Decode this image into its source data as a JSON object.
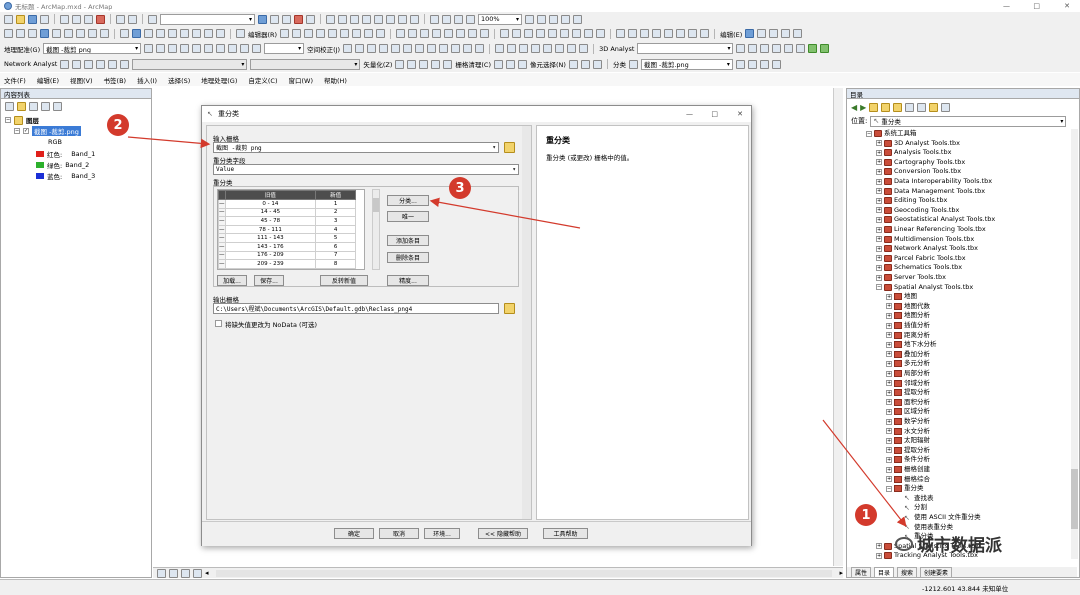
{
  "window": {
    "title": "无标题 - ArcMap.mxd - ArcMap"
  },
  "toolbar2": {
    "scale": "100%"
  },
  "toolbar3": {
    "georef_label": "地理配准(G)",
    "layer_combo": "截图 -裁剪 png",
    "adjust_label": "空间校正(J)",
    "analyst_3d": "3D Analyst"
  },
  "editor_label": "编辑器(R)",
  "edit_label": "编辑(E)",
  "toolbar4": {
    "network_analyst": "Network Analyst",
    "vectorize_label": "矢量化(Z)",
    "raster_clean": "栅格清理(C)",
    "cell_select": "像元选择(N)",
    "classify": "分类",
    "classify_layer": "截图 -裁剪.png"
  },
  "menu": {
    "items": [
      "文件(F)",
      "编辑(E)",
      "视图(V)",
      "书签(B)",
      "插入(I)",
      "选择(S)",
      "地理处理(G)",
      "自定义(C)",
      "窗口(W)",
      "帮助(H)"
    ]
  },
  "toc": {
    "title": "内容列表",
    "layers_root": "图层",
    "layer": "截图 -裁剪.png",
    "rgb": "RGB",
    "bands": [
      {
        "prefix": "红色:",
        "band": "Band_1",
        "color": "#e0201b"
      },
      {
        "prefix": "绿色:",
        "band": "Band_2",
        "color": "#2cb02c"
      },
      {
        "prefix": "蓝色:",
        "band": "Band_3",
        "color": "#1b2fd6"
      }
    ]
  },
  "catalog": {
    "title": "目录",
    "location_label": "位置:",
    "location_value": "重分类",
    "root": "系统工具箱",
    "toolboxes": [
      "3D Analyst Tools.tbx",
      "Analysis Tools.tbx",
      "Cartography Tools.tbx",
      "Conversion Tools.tbx",
      "Data Interoperability Tools.tbx",
      "Data Management Tools.tbx",
      "Editing Tools.tbx",
      "Geocoding Tools.tbx",
      "Geostatistical Analyst Tools.tbx",
      "Linear Referencing Tools.tbx",
      "Multidimension Tools.tbx",
      "Network Analyst Tools.tbx",
      "Parcel Fabric Tools.tbx",
      "Schematics Tools.tbx",
      "Server Tools.tbx",
      "Spatial Analyst Tools.tbx"
    ],
    "spatial_toolsets": [
      "地图",
      "地图代数",
      "地图分析",
      "插值分析",
      "距离分析",
      "地下水分析",
      "叠加分析",
      "多元分析",
      "局部分析",
      "邻域分析",
      "提取分析",
      "面积分析",
      "区域分析",
      "数学分析",
      "水文分析",
      "太阳辐射",
      "提取分析",
      "条件分析",
      "栅格创建",
      "栅格综合",
      "重分类"
    ],
    "reclass_tools": [
      "查找表",
      "分割",
      "使用 ASCII 文件重分类",
      "使用表重分类",
      "重分类"
    ],
    "after": [
      "Spatial Statistics Tools.tbx",
      "Tracking Analyst Tools.tbx"
    ],
    "tabs": [
      "属性",
      "目录",
      "搜索",
      "创建要素"
    ]
  },
  "status": {
    "coords": "-1212.601  43.844 未知单位"
  },
  "dialog": {
    "title": "重分类",
    "input_label": "输入栅格",
    "input_value": "截图 -裁剪 png",
    "field_label": "重分类字段",
    "field_value": "Value",
    "reclass_label": "重分类",
    "col_old": "旧值",
    "col_new": "新值",
    "rows": [
      [
        "0 - 14",
        "1"
      ],
      [
        "14 - 45",
        "2"
      ],
      [
        "45 - 78",
        "3"
      ],
      [
        "78 - 111",
        "4"
      ],
      [
        "111 - 143",
        "5"
      ],
      [
        "143 - 176",
        "6"
      ],
      [
        "176 - 209",
        "7"
      ],
      [
        "209 - 239",
        "8"
      ]
    ],
    "btn_classify": "分类...",
    "btn_unique": "唯一",
    "btn_add": "添加条目",
    "btn_delete": "删除条目",
    "btn_load": "加载...",
    "btn_save": "保存...",
    "btn_reverse": "反转新值",
    "btn_precision": "精度...",
    "output_label": "输出栅格",
    "output_value": "C:\\Users\\程斌\\Documents\\ArcGIS\\Default.gdb\\Reclass_png4",
    "nodata_label": "将缺失值更改为 NoData (可选)",
    "help_title": "重分类",
    "help_text": "重分类 (或更改) 栅格中的值。",
    "btn_ok": "确定",
    "btn_cancel": "取消",
    "btn_env": "环境...",
    "btn_hide_help": "<< 隐藏帮助",
    "btn_tool_help": "工具帮助"
  },
  "annotations": [
    "1",
    "2",
    "3"
  ],
  "watermark": "城市数据派"
}
